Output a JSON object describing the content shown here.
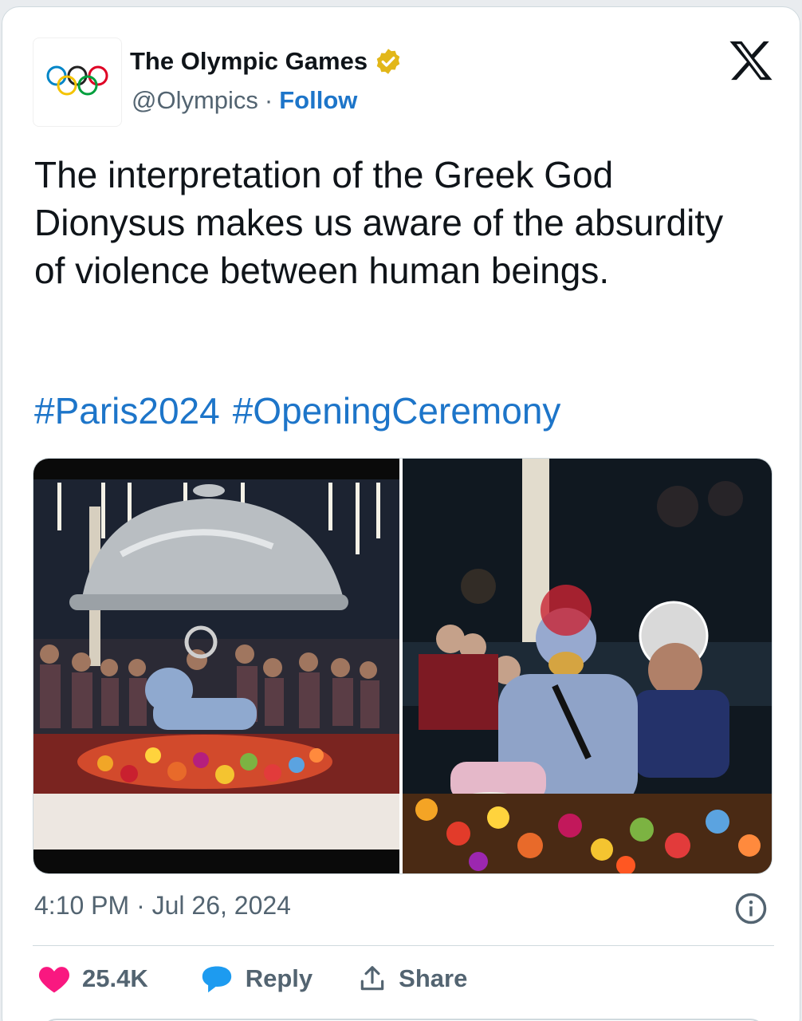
{
  "account": {
    "display_name": "The Olympic Games",
    "handle": "@Olympics",
    "separator": "·",
    "follow_label": "Follow",
    "verified_color": "#e2b719"
  },
  "tweet": {
    "text": "The interpretation of the Greek God Dionysus makes us aware of the absurdity of violence between human beings.",
    "hashtags": [
      "#Paris2024",
      "#OpeningCeremony"
    ]
  },
  "media": {
    "photos": [
      {
        "icon": "opening-ceremony-cloche-table-photo"
      },
      {
        "icon": "opening-ceremony-dionysus-closeup-photo"
      }
    ]
  },
  "timestamp": "4:10 PM · Jul 26, 2024",
  "actions": {
    "likes_count": "25.4K",
    "reply_label": "Reply",
    "share_label": "Share"
  },
  "colors": {
    "link": "#1d75c9",
    "heart": "#f91880",
    "reply": "#1d9bf0",
    "text": "#0f1419",
    "muted": "#536471"
  }
}
